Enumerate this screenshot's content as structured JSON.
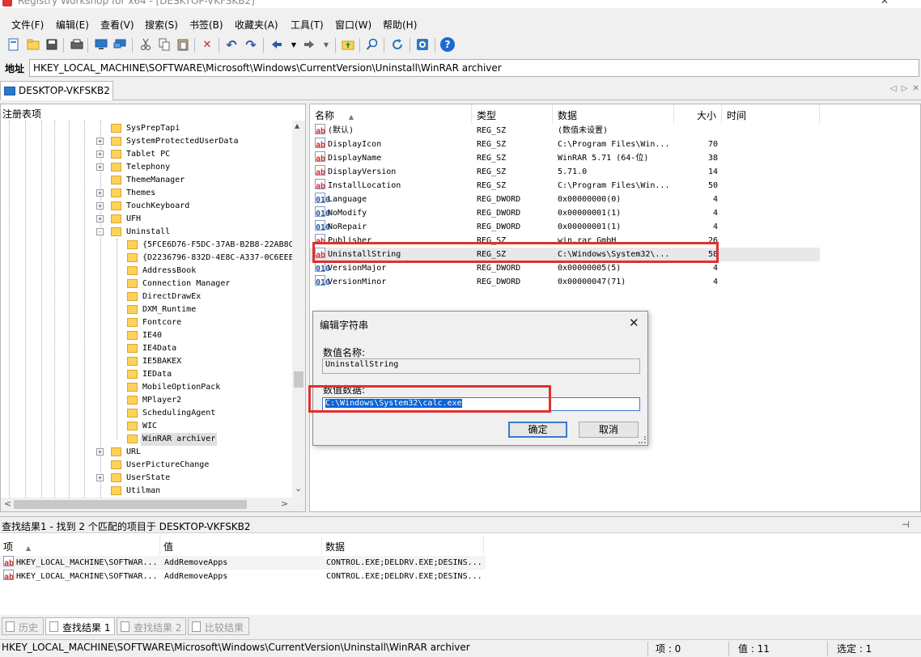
{
  "window": {
    "title": "Registry Workshop for x64 - [DESKTOP-VKFSKB2]"
  },
  "menu": [
    "文件(F)",
    "编辑(E)",
    "查看(V)",
    "搜索(S)",
    "书签(B)",
    "收藏夹(A)",
    "工具(T)",
    "窗口(W)",
    "帮助(H)"
  ],
  "toolbar": {
    "icons": [
      "new-icon",
      "open-icon",
      "save-icon",
      "print-icon",
      "computer-icon",
      "connect-icon",
      "cut-icon",
      "copy-icon",
      "paste-icon",
      "delete-icon",
      "undo-icon",
      "redo-icon",
      "back-icon",
      "forward-icon",
      "up-folder-icon",
      "find-icon",
      "refresh-icon",
      "settings-icon",
      "help-icon"
    ],
    "delete_glyph": "✕",
    "undo_glyph": "↶",
    "redo_glyph": "↷",
    "help_glyph": "?"
  },
  "address": {
    "label": "地址",
    "value": "HKEY_LOCAL_MACHINE\\SOFTWARE\\Microsoft\\Windows\\CurrentVersion\\Uninstall\\WinRAR archiver"
  },
  "doc_tab": {
    "label": "DESKTOP-VKFSKB2"
  },
  "tree": {
    "header": "注册表项",
    "items": [
      {
        "label": "SysPrepTapi",
        "level": 1,
        "expander": ""
      },
      {
        "label": "SystemProtectedUserData",
        "level": 1,
        "expander": "+"
      },
      {
        "label": "Tablet PC",
        "level": 1,
        "expander": "+"
      },
      {
        "label": "Telephony",
        "level": 1,
        "expander": "+"
      },
      {
        "label": "ThemeManager",
        "level": 1,
        "expander": ""
      },
      {
        "label": "Themes",
        "level": 1,
        "expander": "+"
      },
      {
        "label": "TouchKeyboard",
        "level": 1,
        "expander": "+"
      },
      {
        "label": "UFH",
        "level": 1,
        "expander": "+"
      },
      {
        "label": "Uninstall",
        "level": 1,
        "expander": "-"
      },
      {
        "label": "{5FCE6D76-F5DC-37AB-B2B8-22AB8C",
        "level": 2,
        "expander": ""
      },
      {
        "label": "{D2236796-832D-4E8C-A337-0C6EEE",
        "level": 2,
        "expander": ""
      },
      {
        "label": "AddressBook",
        "level": 2,
        "expander": ""
      },
      {
        "label": "Connection Manager",
        "level": 2,
        "expander": ""
      },
      {
        "label": "DirectDrawEx",
        "level": 2,
        "expander": ""
      },
      {
        "label": "DXM_Runtime",
        "level": 2,
        "expander": ""
      },
      {
        "label": "Fontcore",
        "level": 2,
        "expander": ""
      },
      {
        "label": "IE40",
        "level": 2,
        "expander": ""
      },
      {
        "label": "IE4Data",
        "level": 2,
        "expander": ""
      },
      {
        "label": "IE5BAKEX",
        "level": 2,
        "expander": ""
      },
      {
        "label": "IEData",
        "level": 2,
        "expander": ""
      },
      {
        "label": "MobileOptionPack",
        "level": 2,
        "expander": ""
      },
      {
        "label": "MPlayer2",
        "level": 2,
        "expander": ""
      },
      {
        "label": "SchedulingAgent",
        "level": 2,
        "expander": ""
      },
      {
        "label": "WIC",
        "level": 2,
        "expander": ""
      },
      {
        "label": "WinRAR archiver",
        "level": 2,
        "expander": "",
        "selected": true
      },
      {
        "label": "URL",
        "level": 1,
        "expander": "+"
      },
      {
        "label": "UserPictureChange",
        "level": 1,
        "expander": ""
      },
      {
        "label": "UserState",
        "level": 1,
        "expander": "+"
      },
      {
        "label": "Utilman",
        "level": 1,
        "expander": ""
      }
    ],
    "scroll_up": "▲",
    "scroll_down": "⌄",
    "scroll_left": "<",
    "scroll_right": ">"
  },
  "values_list": {
    "columns": {
      "name": "名称",
      "type": "类型",
      "data": "数据",
      "size": "大小",
      "time": "时间",
      "sort_glyph": "▲"
    },
    "rows": [
      {
        "name": "(默认)",
        "type": "REG_SZ",
        "data": "(数值未设置)",
        "size": "",
        "kind": "sz"
      },
      {
        "name": "DisplayIcon",
        "type": "REG_SZ",
        "data": "C:\\Program Files\\Win...",
        "size": "70",
        "kind": "sz"
      },
      {
        "name": "DisplayName",
        "type": "REG_SZ",
        "data": "WinRAR 5.71 (64-位)",
        "size": "38",
        "kind": "sz"
      },
      {
        "name": "DisplayVersion",
        "type": "REG_SZ",
        "data": "5.71.0",
        "size": "14",
        "kind": "sz"
      },
      {
        "name": "InstallLocation",
        "type": "REG_SZ",
        "data": "C:\\Program Files\\Win...",
        "size": "50",
        "kind": "sz"
      },
      {
        "name": "Language",
        "type": "REG_DWORD",
        "data": "0x00000000(0)",
        "size": "4",
        "kind": "dword"
      },
      {
        "name": "NoModify",
        "type": "REG_DWORD",
        "data": "0x00000001(1)",
        "size": "4",
        "kind": "dword"
      },
      {
        "name": "NoRepair",
        "type": "REG_DWORD",
        "data": "0x00000001(1)",
        "size": "4",
        "kind": "dword"
      },
      {
        "name": "Publisher",
        "type": "REG_SZ",
        "data": "win.rar GmbH",
        "size": "26",
        "kind": "sz"
      },
      {
        "name": "UninstallString",
        "type": "REG_SZ",
        "data": "C:\\Windows\\System32\\...",
        "size": "58",
        "kind": "sz",
        "selected": true
      },
      {
        "name": "VersionMajor",
        "type": "REG_DWORD",
        "data": "0x00000005(5)",
        "size": "4",
        "kind": "dword"
      },
      {
        "name": "VersionMinor",
        "type": "REG_DWORD",
        "data": "0x00000047(71)",
        "size": "4",
        "kind": "dword"
      }
    ],
    "sz_icon_text": "ab",
    "dword_icon_text": "010"
  },
  "edit_dialog": {
    "title": "编辑字符串",
    "close_glyph": "✕",
    "name_label": "数值名称:",
    "name_value": "UninstallString",
    "data_label": "数值数据:",
    "data_value": "C:\\Windows\\System32\\calc.exe",
    "ok": "确定",
    "cancel": "取消"
  },
  "find_results": {
    "title": "查找结果1 - 找到 2 个匹配的项目于 DESKTOP-VKFSKB2",
    "pin_glyph": "⊣",
    "columns": {
      "item": "项",
      "value": "值",
      "data": "数据",
      "sort_glyph": "▲"
    },
    "rows": [
      {
        "item": "HKEY_LOCAL_MACHINE\\SOFTWAR...",
        "value": "AddRemoveApps",
        "data": "CONTROL.EXE;DELDRV.EXE;DESINS..."
      },
      {
        "item": "HKEY_LOCAL_MACHINE\\SOFTWAR...",
        "value": "AddRemoveApps",
        "data": "CONTROL.EXE;DELDRV.EXE;DESINS..."
      }
    ]
  },
  "bottom_tabs": [
    {
      "label": "历史",
      "active": false
    },
    {
      "label": "查找结果 1",
      "active": true
    },
    {
      "label": "查找结果 2",
      "active": false
    },
    {
      "label": "比较结果",
      "active": false
    }
  ],
  "status": {
    "path": "HKEY_LOCAL_MACHINE\\SOFTWARE\\Microsoft\\Windows\\CurrentVersion\\Uninstall\\WinRAR archiver",
    "items": "项 : 0",
    "values": "值 : 11",
    "selected": "选定 : 1"
  },
  "colors": {
    "highlight": "#e03030",
    "selection": "#0a64d6",
    "folder": "#ffd25a"
  }
}
